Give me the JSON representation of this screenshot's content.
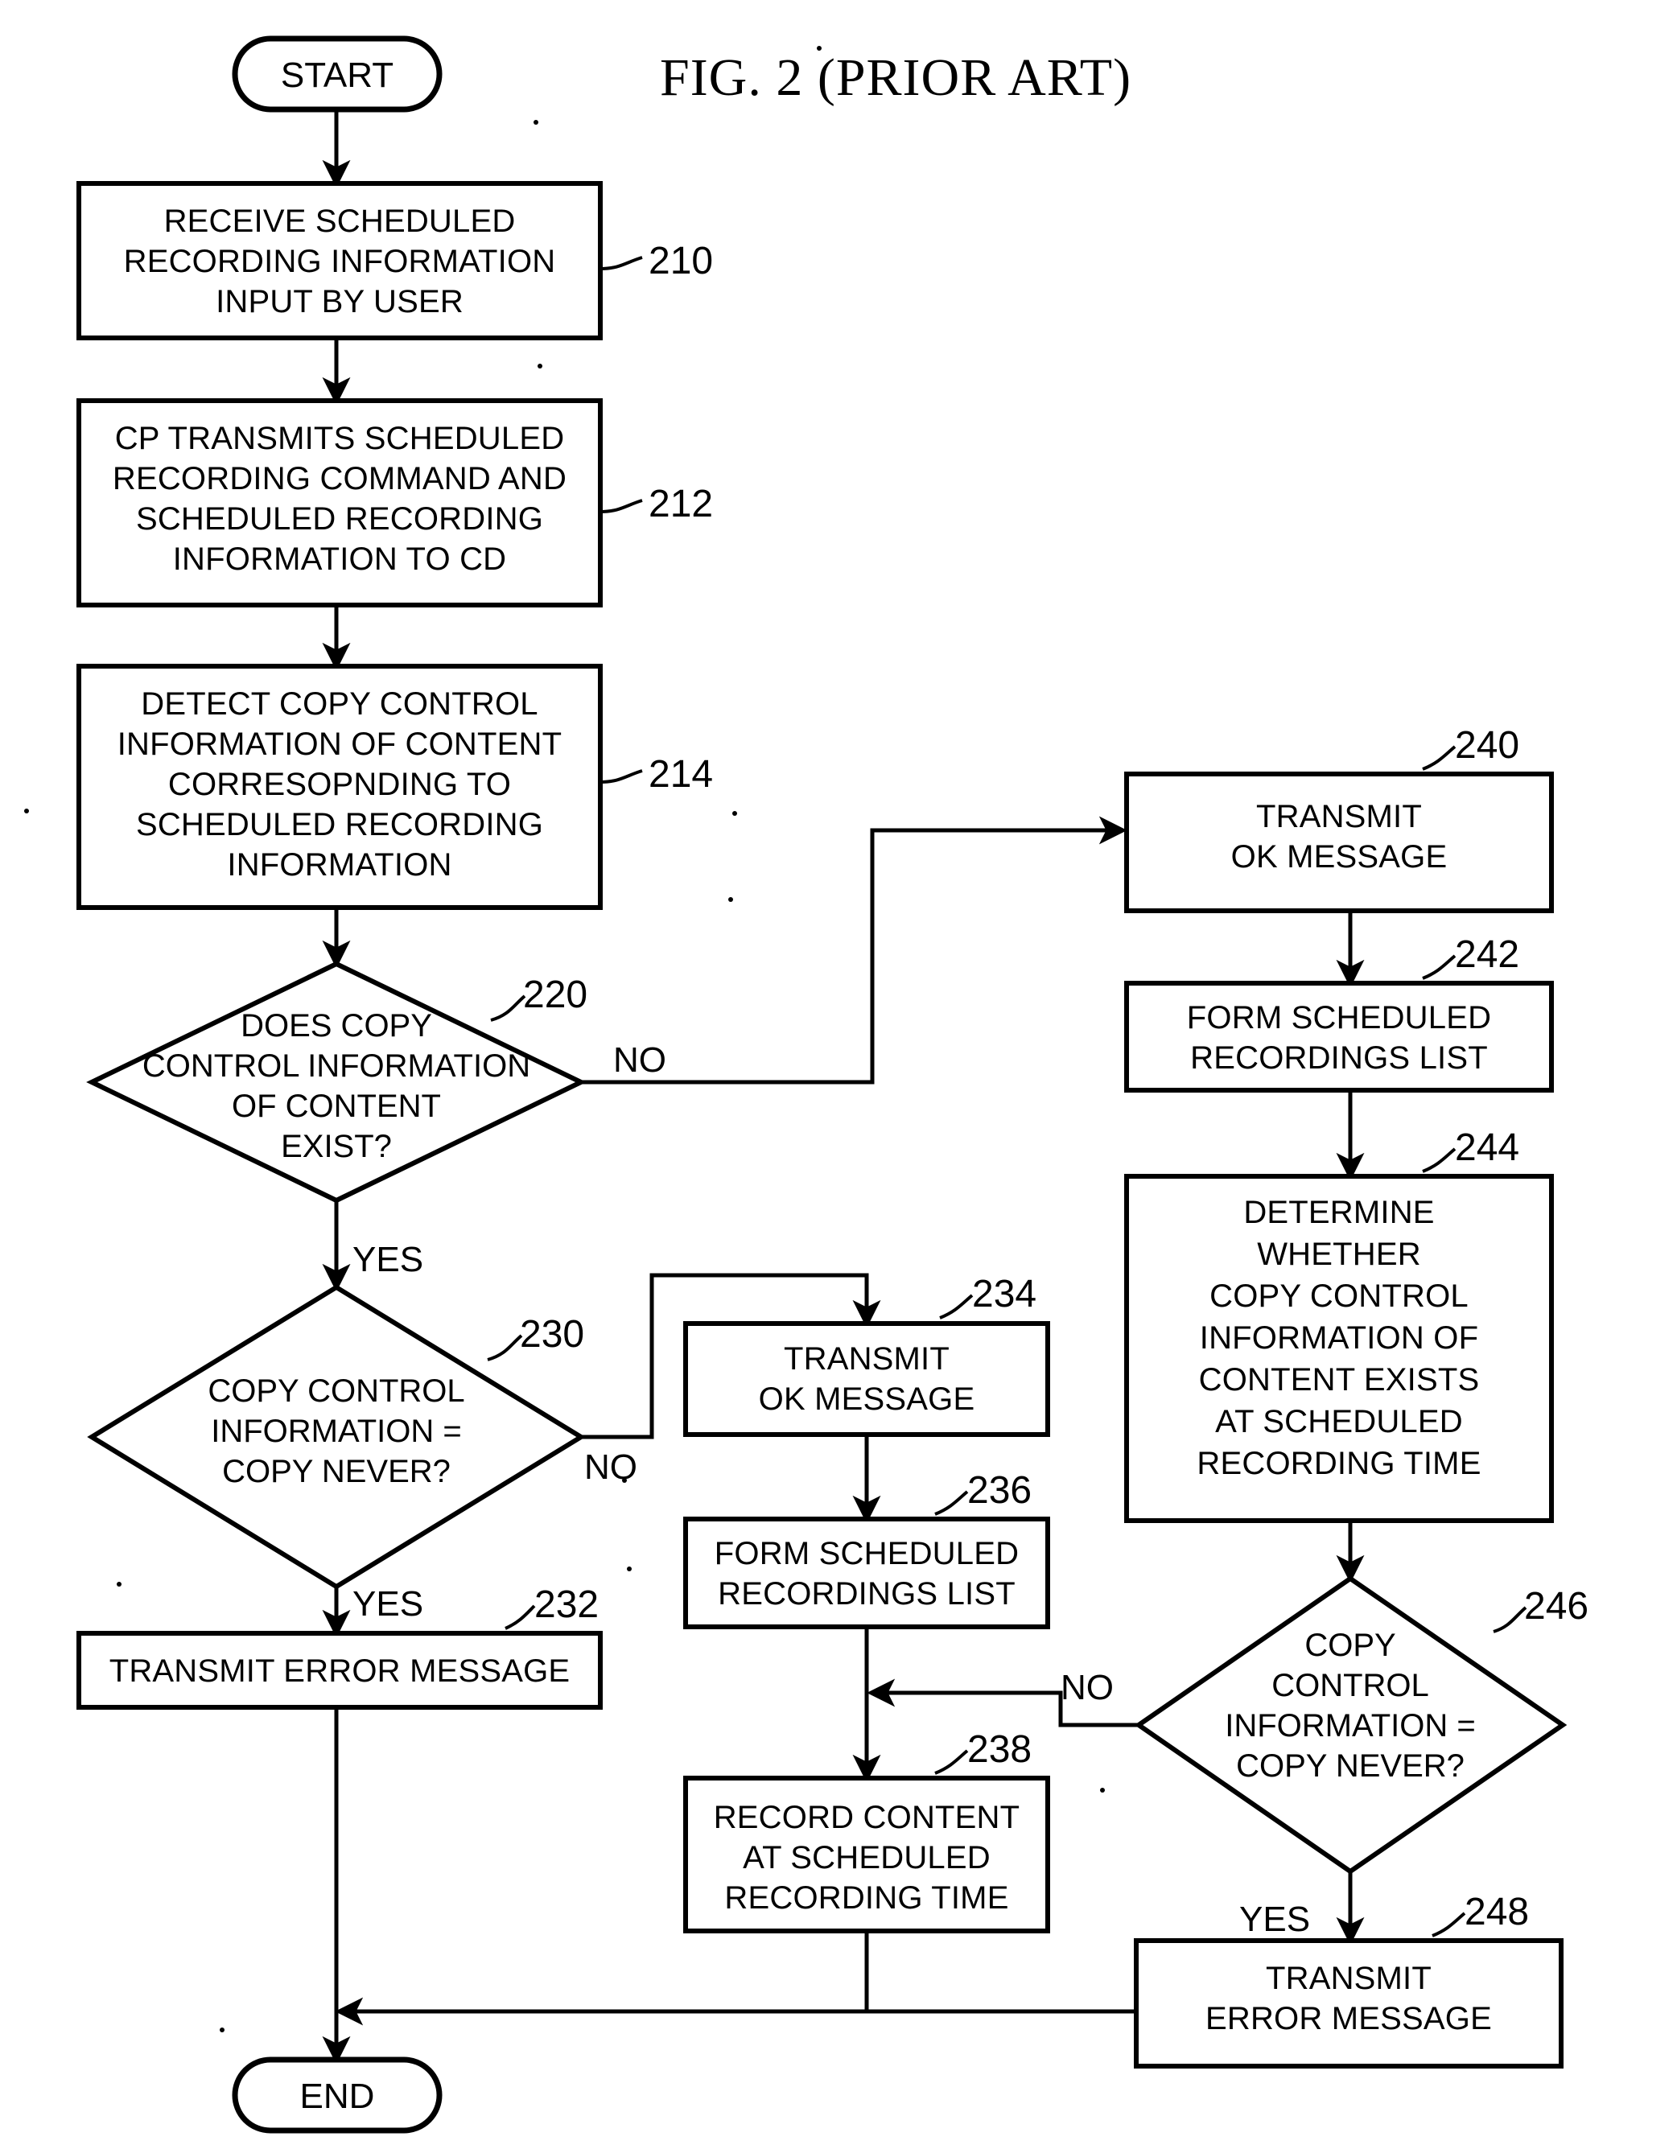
{
  "figure": {
    "title": "FIG. 2 (PRIOR ART)"
  },
  "terminals": {
    "start": "START",
    "end": "END"
  },
  "edge_labels": {
    "no_220": "NO",
    "yes_220": "YES",
    "no_230": "NO",
    "yes_230": "YES",
    "no_246": "NO",
    "yes_246": "YES"
  },
  "nodes": {
    "n210": {
      "ref": "210",
      "lines": [
        "RECEIVE SCHEDULED",
        "RECORDING INFORMATION",
        "INPUT BY USER"
      ]
    },
    "n212": {
      "ref": "212",
      "lines": [
        "CP TRANSMITS SCHEDULED",
        "RECORDING COMMAND AND",
        "SCHEDULED RECORDING",
        "INFORMATION TO CD"
      ]
    },
    "n214": {
      "ref": "214",
      "lines": [
        "DETECT COPY CONTROL",
        "INFORMATION OF CONTENT",
        "CORRESOPNDING TO",
        "SCHEDULED RECORDING",
        "INFORMATION"
      ]
    },
    "n220": {
      "ref": "220",
      "lines": [
        "DOES COPY",
        "CONTROL INFORMATION",
        "OF CONTENT",
        "EXIST?"
      ]
    },
    "n230": {
      "ref": "230",
      "lines": [
        "COPY CONTROL",
        "INFORMATION =",
        "COPY NEVER?"
      ]
    },
    "n232": {
      "ref": "232",
      "lines": [
        "TRANSMIT ERROR MESSAGE"
      ]
    },
    "n234": {
      "ref": "234",
      "lines": [
        "TRANSMIT",
        "OK MESSAGE"
      ]
    },
    "n236": {
      "ref": "236",
      "lines": [
        "FORM SCHEDULED",
        "RECORDINGS LIST"
      ]
    },
    "n238": {
      "ref": "238",
      "lines": [
        "RECORD CONTENT",
        "AT SCHEDULED",
        "RECORDING TIME"
      ]
    },
    "n240": {
      "ref": "240",
      "lines": [
        "TRANSMIT",
        "OK MESSAGE"
      ]
    },
    "n242": {
      "ref": "242",
      "lines": [
        "FORM SCHEDULED",
        "RECORDINGS LIST"
      ]
    },
    "n244": {
      "ref": "244",
      "lines": [
        "DETERMINE",
        "WHETHER",
        "COPY CONTROL",
        "INFORMATION OF",
        "CONTENT EXISTS",
        "AT SCHEDULED",
        "RECORDING TIME"
      ]
    },
    "n246": {
      "ref": "246",
      "lines": [
        "COPY",
        "CONTROL",
        "INFORMATION =",
        "COPY NEVER?"
      ]
    },
    "n248": {
      "ref": "248",
      "lines": [
        "TRANSMIT",
        "ERROR MESSAGE"
      ]
    }
  },
  "colors": {
    "ink": "#000000",
    "paper": "#ffffff"
  }
}
